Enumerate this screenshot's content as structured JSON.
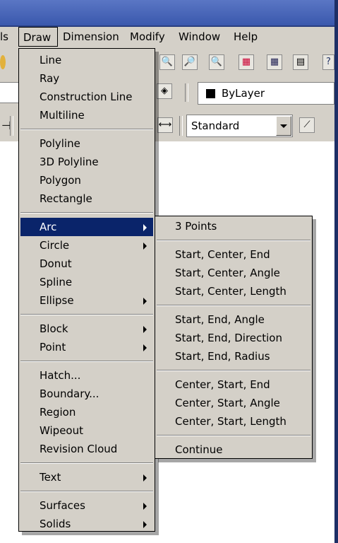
{
  "menubar": {
    "items": [
      "ls",
      "Draw",
      "Dimension",
      "Modify",
      "Window",
      "Help"
    ]
  },
  "toolbar": {
    "layer_value": "ByLayer",
    "style_value": "Standard",
    "left_fragment": "⊣"
  },
  "draw_menu": {
    "groups": [
      [
        {
          "label": "Line"
        },
        {
          "label": "Ray"
        },
        {
          "label": "Construction Line"
        },
        {
          "label": "Multiline"
        }
      ],
      [
        {
          "label": "Polyline"
        },
        {
          "label": "3D Polyline"
        },
        {
          "label": "Polygon"
        },
        {
          "label": "Rectangle"
        }
      ],
      [
        {
          "label": "Arc",
          "submenu": true,
          "highlighted": true
        },
        {
          "label": "Circle",
          "submenu": true
        },
        {
          "label": "Donut"
        },
        {
          "label": "Spline"
        },
        {
          "label": "Ellipse",
          "submenu": true
        }
      ],
      [
        {
          "label": "Block",
          "submenu": true
        },
        {
          "label": "Point",
          "submenu": true
        }
      ],
      [
        {
          "label": "Hatch..."
        },
        {
          "label": "Boundary..."
        },
        {
          "label": "Region"
        },
        {
          "label": "Wipeout"
        },
        {
          "label": "Revision Cloud"
        }
      ],
      [
        {
          "label": "Text",
          "submenu": true
        }
      ],
      [
        {
          "label": "Surfaces",
          "submenu": true
        },
        {
          "label": "Solids",
          "submenu": true
        }
      ]
    ]
  },
  "arc_submenu": {
    "groups": [
      [
        "3 Points"
      ],
      [
        "Start, Center, End",
        "Start, Center, Angle",
        "Start, Center, Length"
      ],
      [
        "Start, End, Angle",
        "Start, End, Direction",
        "Start, End, Radius"
      ],
      [
        "Center, Start, End",
        "Center, Start, Angle",
        "Center, Start, Length"
      ],
      [
        "Continue"
      ]
    ]
  },
  "colors": {
    "menu_bg": "#d4d0c8",
    "highlight": "#0a246a",
    "titlebar": "#3a58ad"
  }
}
